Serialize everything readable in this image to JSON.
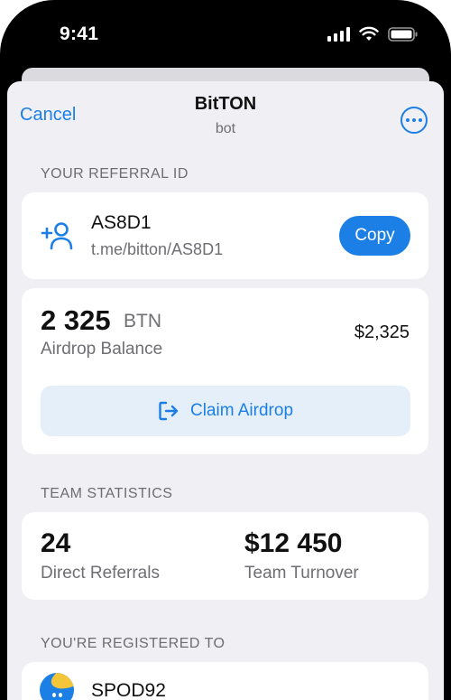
{
  "status": {
    "time": "9:41"
  },
  "nav": {
    "cancel": "Cancel",
    "title": "BitTON",
    "subtitle": "bot",
    "more_icon": "ellipsis-circle-icon"
  },
  "referral": {
    "section_label": "YOUR REFERRAL ID",
    "id": "AS8D1",
    "link": "t.me/bitton/AS8D1",
    "copy_label": "Copy",
    "icon": "add-user-icon"
  },
  "balance": {
    "amount": "2 325",
    "unit": "BTN",
    "label": "Airdrop Balance",
    "usd": "$2,325",
    "claim_label": "Claim Airdrop",
    "claim_icon": "sign-out-icon"
  },
  "team": {
    "section_label": "TEAM STATISTICS",
    "direct_referrals_value": "24",
    "direct_referrals_label": "Direct Referrals",
    "turnover_value": "$12 450",
    "turnover_label": "Team Turnover"
  },
  "registered": {
    "section_label": "YOU'RE REGISTERED TO",
    "name": "SPOD92"
  },
  "colors": {
    "accent": "#1c7fe6",
    "background": "#efeff4",
    "card": "#ffffff",
    "secondary_text": "#6e6e73"
  }
}
